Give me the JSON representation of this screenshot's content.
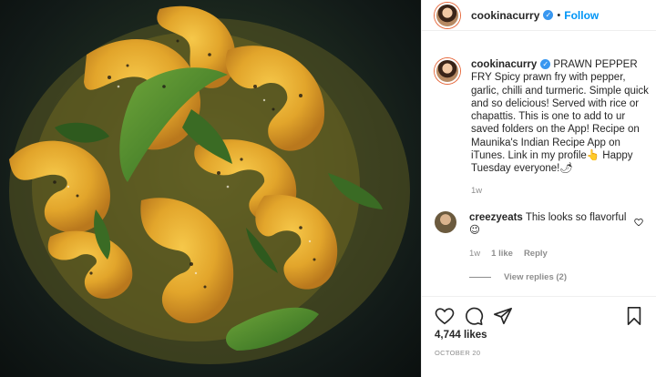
{
  "post": {
    "username": "cookinacurry",
    "verified": true,
    "follow_label": "Follow",
    "separator": "•"
  },
  "caption": {
    "username": "cookinacurry",
    "text": " PRAWN PEPPER FRY Spicy prawn fry with pepper, garlic, chilli and turmeric. Simple quick and so delicious! Served with rice or chapattis. This is one to add to ur saved folders on the App! Recipe on Maunika's Indian Recipe App on iTunes. Link in my profile👆 Happy Tuesday everyone!🌶",
    "time": "1w"
  },
  "comment": {
    "username": "creezyeats",
    "text": "This looks so flavorful 😉",
    "time": "1w",
    "likes": "1 like",
    "reply_label": "Reply",
    "view_replies": "View replies (2)"
  },
  "actions": {
    "like_icon": "heart-icon",
    "comment_icon": "comment-bubble-icon",
    "share_icon": "paper-plane-icon",
    "save_icon": "bookmark-icon"
  },
  "stats": {
    "likes": "4,744 likes",
    "date": "OCTOBER 20"
  },
  "colors": {
    "link": "#0095f6",
    "muted": "#8e8e8e",
    "text": "#262626",
    "verified": "#3897f0"
  }
}
